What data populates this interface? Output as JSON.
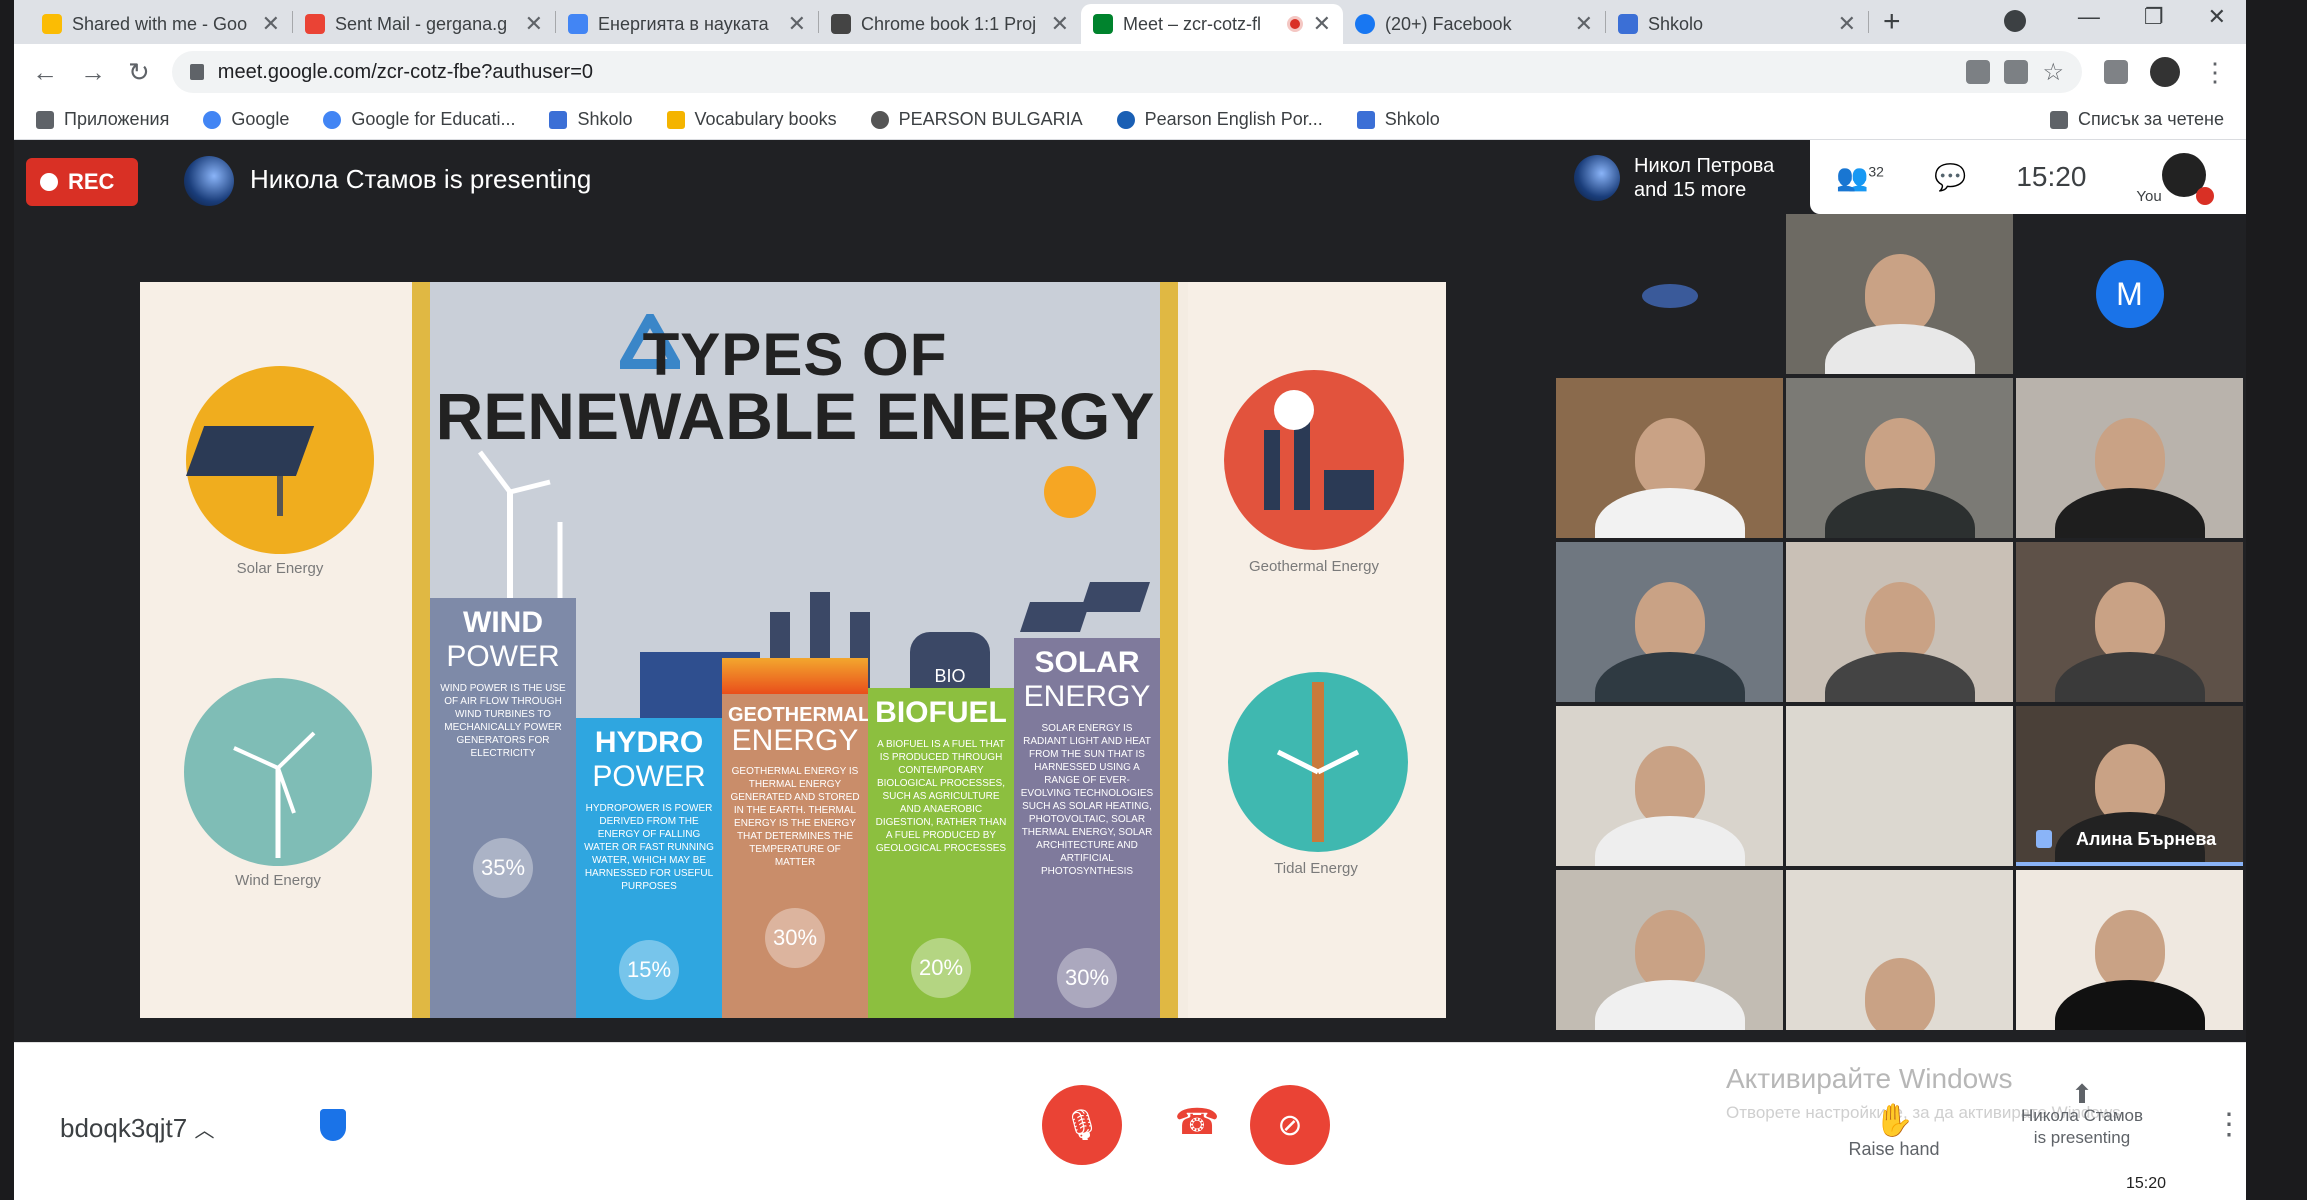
{
  "browser": {
    "tabs": [
      {
        "label": "Shared with me - Goo",
        "favicon": "drive-icon",
        "color": "#fbbc04",
        "active": false
      },
      {
        "label": "Sent Mail - gergana.g",
        "favicon": "gmail-icon",
        "color": "#ea4335",
        "active": false
      },
      {
        "label": "Енергията в науката",
        "favicon": "docs-icon",
        "color": "#4285f4",
        "active": false
      },
      {
        "label": "Chrome book 1:1 Proj",
        "favicon": "classroom-icon",
        "color": "#444444",
        "active": false
      },
      {
        "label": "Meet – zcr-cotz-fl",
        "favicon": "meet-icon",
        "color": "#00832d",
        "active": true
      },
      {
        "label": "(20+) Facebook",
        "favicon": "facebook-icon",
        "color": "#1877f2",
        "active": false
      },
      {
        "label": "Shkolo",
        "favicon": "shkolo-icon",
        "color": "#3b6fd6",
        "active": false
      }
    ],
    "url": "meet.google.com/zcr-cotz-fbe?authuser=0",
    "bookmarks": [
      {
        "label": "Приложения",
        "color": "#5f6368"
      },
      {
        "label": "Google",
        "color": "#4285f4"
      },
      {
        "label": "Google for Educati...",
        "color": "#4285f4"
      },
      {
        "label": "Shkolo",
        "color": "#3b6fd6"
      },
      {
        "label": "Vocabulary books",
        "color": "#f4b400"
      },
      {
        "label": "PEARSON BULGARIA",
        "color": "#555555"
      },
      {
        "label": "Pearson English Por...",
        "color": "#1a5fb4"
      },
      {
        "label": "Shkolo",
        "color": "#3b6fd6"
      }
    ],
    "reading_list": "Списък за четене"
  },
  "meet": {
    "rec_label": "REC",
    "presenting_text": "Никола Стамов is presenting",
    "pinned_name": "Никол Петрова",
    "pinned_more": "and 15 more",
    "participant_count": "32",
    "clock": "15:20",
    "you_label": "You",
    "m_initial": "M",
    "speaking_name": "Алина Бърнева",
    "meeting_code": "bdoqk3qjt7",
    "raise_hand": "Raise hand",
    "presenter_note_line1": "Никола Стамов",
    "presenter_note_line2": "is presenting",
    "activate_windows": "Активирайте Windows",
    "activate_windows_sub": "Отворете настройките, за да активирате Windows.",
    "taskbar_time": "15:20"
  },
  "slide": {
    "title_line1": "TYPES OF",
    "title_line2": "RENEWABLE ENERGY",
    "solar_label": "Solar Energy",
    "wind_label": "Wind Energy",
    "geothermal_label": "Geothermal Energy",
    "tidal_label": "Tidal Energy",
    "bio_tag": "BIO",
    "columns": [
      {
        "name1": "WIND",
        "name2": "POWER",
        "desc": "WIND POWER IS THE USE OF AIR FLOW THROUGH WIND TURBINES TO MECHANICALLY POWER GENERATORS FOR ELECTRICITY",
        "pct": "35%",
        "color": "#7e8aa8"
      },
      {
        "name1": "HYDRO",
        "name2": "POWER",
        "desc": "HYDROPOWER IS POWER DERIVED FROM THE ENERGY OF FALLING WATER OR FAST RUNNING WATER, WHICH MAY BE HARNESSED FOR USEFUL PURPOSES",
        "pct": "15%",
        "color": "#2fa6e0"
      },
      {
        "name1": "GEOTHERMAL",
        "name2": "ENERGY",
        "desc": "GEOTHERMAL ENERGY IS THERMAL ENERGY GENERATED AND STORED IN THE EARTH. THERMAL ENERGY IS THE ENERGY THAT DETERMINES THE TEMPERATURE OF MATTER",
        "pct": "30%",
        "color": "#c98d6a"
      },
      {
        "name1": "BIOFUEL",
        "name2": "",
        "desc": "A BIOFUEL IS A FUEL THAT IS PRODUCED THROUGH CONTEMPORARY BIOLOGICAL PROCESSES, SUCH AS AGRICULTURE AND ANAEROBIC DIGESTION, RATHER THAN A FUEL PRODUCED BY GEOLOGICAL PROCESSES",
        "pct": "20%",
        "color": "#8cbf3f"
      },
      {
        "name1": "SOLAR",
        "name2": "ENERGY",
        "desc": "SOLAR ENERGY IS RADIANT LIGHT AND HEAT FROM THE SUN THAT IS HARNESSED USING A RANGE OF EVER-EVOLVING TECHNOLOGIES SUCH AS SOLAR HEATING, PHOTOVOLTAIC, SOLAR THERMAL ENERGY, SOLAR ARCHITECTURE AND ARTIFICIAL PHOTOSYNTHESIS",
        "pct": "30%",
        "color": "#7f7a9c"
      }
    ]
  }
}
